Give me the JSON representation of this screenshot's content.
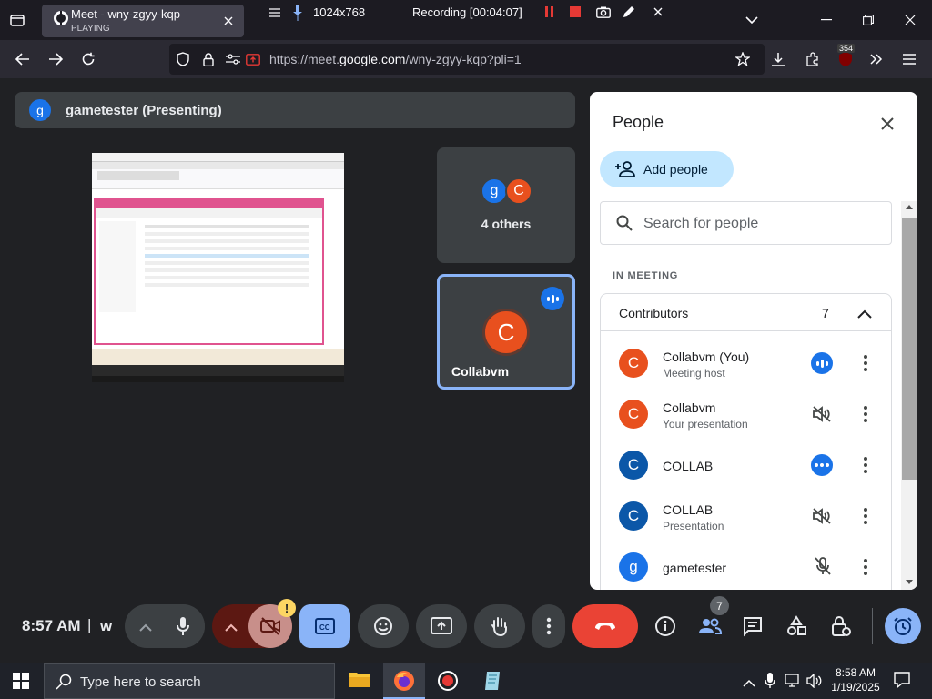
{
  "browser": {
    "tab": {
      "title": "Meet - wny-zgyy-kqp",
      "subtitle": "PLAYING"
    },
    "recorder": {
      "resolution": "1024x768",
      "status": "Recording [00:04:07]"
    },
    "url_prefix": "https://meet.",
    "url_domain": "google.com",
    "url_path": "/wny-zgyy-kqp?pli=1",
    "extension_badge": "354"
  },
  "meet": {
    "presenter": {
      "initial": "g",
      "label": "gametester (Presenting)"
    },
    "tiles": {
      "others": {
        "initials": [
          "g",
          "C"
        ],
        "label": "4 others"
      },
      "self": {
        "initial": "C",
        "label": "Collabvm"
      }
    }
  },
  "people_panel": {
    "title": "People",
    "add_people": "Add people",
    "search_placeholder": "Search for people",
    "section_label": "IN MEETING",
    "group": {
      "label": "Contributors",
      "count": "7"
    },
    "participants": [
      {
        "initial": "C",
        "name": "Collabvm (You)",
        "sub": "Meeting host",
        "avatar_color": "#e8501e",
        "status": "speaking-icon"
      },
      {
        "initial": "C",
        "name": "Collabvm",
        "sub": "Your presentation",
        "avatar_color": "#e8501e",
        "status": "volume-muted-icon"
      },
      {
        "initial": "C",
        "name": "COLLAB",
        "sub": "",
        "avatar_color": "#0b57a8",
        "status": "more-dots-icon"
      },
      {
        "initial": "C",
        "name": "COLLAB",
        "sub": "Presentation",
        "avatar_color": "#0b57a8",
        "status": "volume-muted-icon"
      },
      {
        "initial": "g",
        "name": "gametester",
        "sub": "",
        "avatar_color": "#1a73e8",
        "status": "mic-off-icon"
      }
    ]
  },
  "controls": {
    "time": "8:57 AM",
    "separator": "|",
    "meeting_code_fragment": "w",
    "people_badge": "7",
    "camera_warning": "!"
  },
  "taskbar": {
    "search_placeholder": "Type here to search",
    "time": "8:58 AM",
    "date": "1/19/2025"
  },
  "colors": {
    "accent_blue": "#8ab4f8",
    "end_call_red": "#ea4335",
    "panel_bg": "#ffffff",
    "meet_bg": "#202124"
  }
}
